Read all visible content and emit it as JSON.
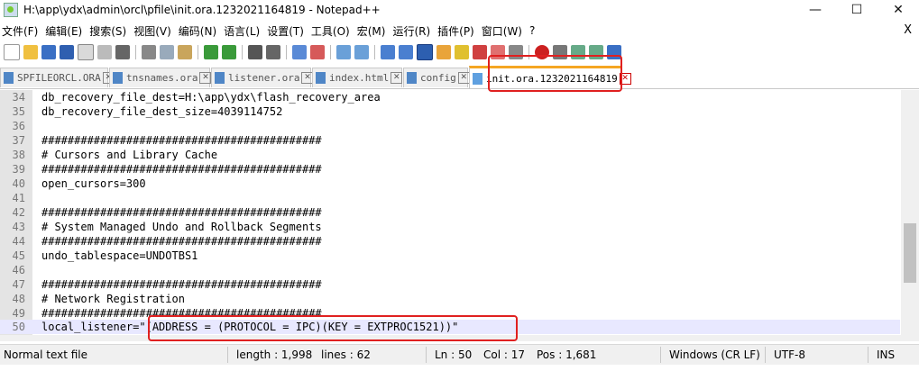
{
  "window": {
    "title": "H:\\app\\ydx\\admin\\orcl\\pfile\\init.ora.1232021164819 - Notepad++",
    "minimize": "—",
    "maximize": "☐",
    "close": "✕"
  },
  "menu": {
    "items": [
      "文件(F)",
      "编辑(E)",
      "搜索(S)",
      "视图(V)",
      "编码(N)",
      "语言(L)",
      "设置(T)",
      "工具(O)",
      "宏(M)",
      "运行(R)",
      "插件(P)",
      "窗口(W)",
      "?"
    ],
    "close_doc": "X"
  },
  "tabs": [
    {
      "label": "SPFILEORCL.ORA",
      "close": "✕"
    },
    {
      "label": "tnsnames.ora",
      "close": "✕"
    },
    {
      "label": "listener.ora",
      "close": "✕"
    },
    {
      "label": "index.html",
      "close": "✕"
    },
    {
      "label": "config",
      "close": "✕"
    },
    {
      "label": "init.ora.1232021164819",
      "close": "✕"
    }
  ],
  "editor": {
    "lines": [
      {
        "n": "34",
        "text": "db_recovery_file_dest=H:\\app\\ydx\\flash_recovery_area"
      },
      {
        "n": "35",
        "text": "db_recovery_file_dest_size=4039114752"
      },
      {
        "n": "36",
        "text": ""
      },
      {
        "n": "37",
        "text": "###########################################"
      },
      {
        "n": "38",
        "text": "# Cursors and Library Cache"
      },
      {
        "n": "39",
        "text": "###########################################"
      },
      {
        "n": "40",
        "text": "open_cursors=300"
      },
      {
        "n": "41",
        "text": ""
      },
      {
        "n": "42",
        "text": "###########################################"
      },
      {
        "n": "43",
        "text": "# System Managed Undo and Rollback Segments"
      },
      {
        "n": "44",
        "text": "###########################################"
      },
      {
        "n": "45",
        "text": "undo_tablespace=UNDOTBS1"
      },
      {
        "n": "46",
        "text": ""
      },
      {
        "n": "47",
        "text": "###########################################"
      },
      {
        "n": "48",
        "text": "# Network Registration"
      },
      {
        "n": "49",
        "text": "###########################################"
      },
      {
        "n": "50",
        "text": "local_listener=\"(ADDRESS = (PROTOCOL = IPC)(KEY = EXTPROC1521))\""
      }
    ]
  },
  "status": {
    "file_type": "Normal text file",
    "length": "length : 1,998",
    "lines": "lines : 62",
    "ln": "Ln : 50",
    "col": "Col : 17",
    "pos": "Pos : 1,681",
    "eol": "Windows (CR LF)",
    "encoding": "UTF-8",
    "mode": "INS"
  },
  "colors": {
    "accent_tab": "#f5a623",
    "annotation": "#e02020",
    "current_line": "#e8e8ff"
  }
}
